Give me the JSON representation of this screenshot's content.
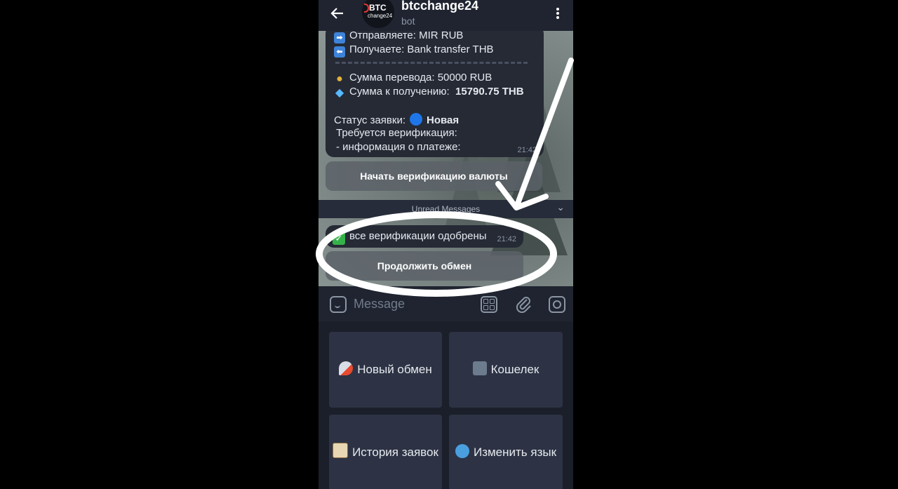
{
  "header": {
    "title": "btcchange24",
    "subtitle": "bot",
    "avatar": {
      "line1": "BTC",
      "line2": "change24"
    }
  },
  "message1": {
    "line_send": "Отправляете: MIR RUB",
    "line_receive": "Получаете: Bank transfer THB",
    "line_amount": "Сумма перевода: 50000 RUB",
    "line_get_label": "Сумма к получению:",
    "line_get_value": "15790.75 THB",
    "status_label": "Статус заявки:",
    "status_value": "Новая",
    "verify_required": "Требуется верификация:",
    "verify_item": "- информация о платеже:",
    "time": "21:42"
  },
  "inline_button_1": "Начать верификацию валюты",
  "unread_label": "Unread Messages",
  "message2": {
    "text": "все верификации одобрены",
    "time": "21:42"
  },
  "inline_button_2": "Продолжить обмен",
  "input": {
    "placeholder": "Message"
  },
  "keyboard": [
    {
      "label": "Новый обмен",
      "icon": "rocket-icon"
    },
    {
      "label": "Кошелек",
      "icon": "folder-icon"
    },
    {
      "label": "История заявок",
      "icon": "clipboard-icon"
    },
    {
      "label": "Изменить язык",
      "icon": "globe-icon"
    }
  ],
  "colors": {
    "header_bg": "#1f2430",
    "bubble_bg": "#252a35",
    "keyboard_btn_bg": "#2d3344",
    "annotation": "#ffffff"
  }
}
